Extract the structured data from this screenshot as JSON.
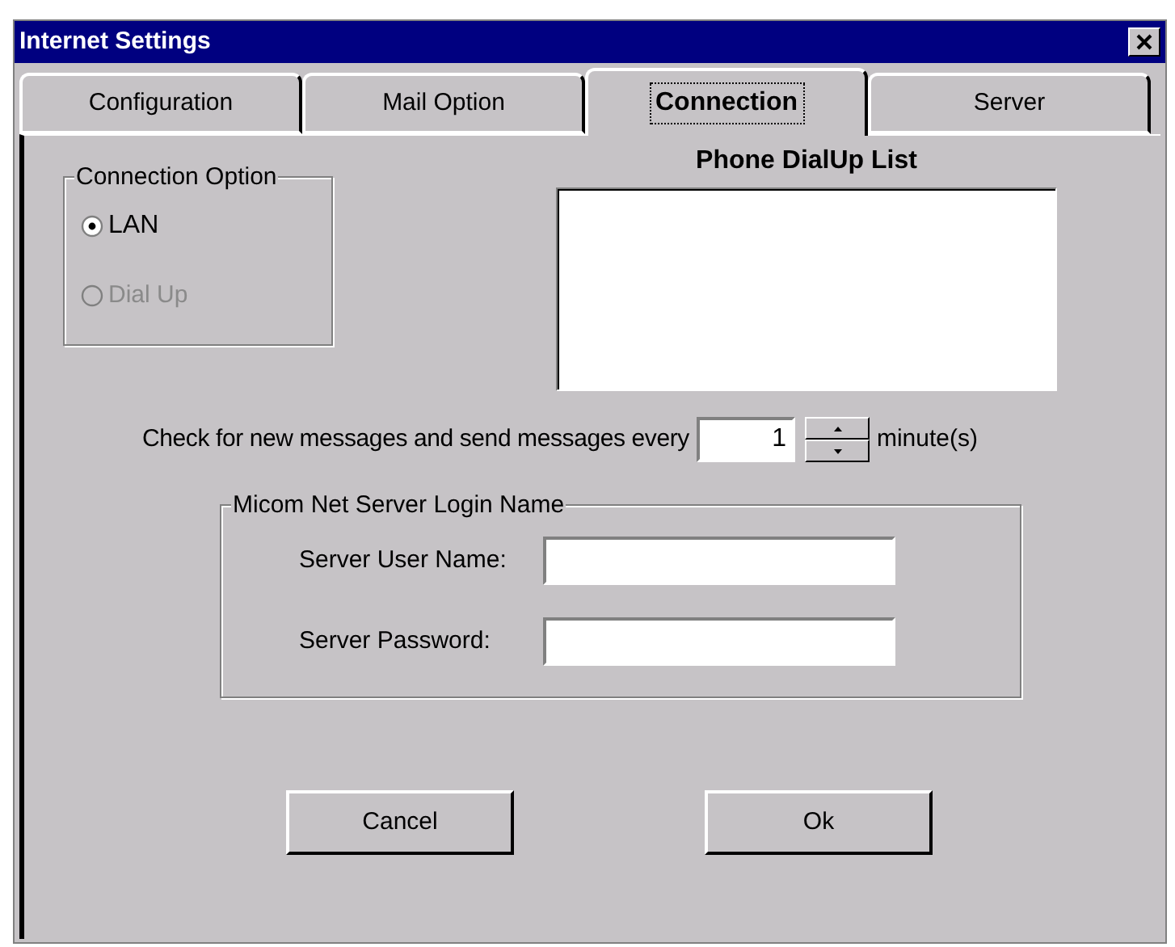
{
  "window": {
    "title": "Internet Settings"
  },
  "tabs": [
    {
      "label": "Configuration",
      "selected": false
    },
    {
      "label": "Mail Option",
      "selected": false
    },
    {
      "label": "Connection",
      "selected": true
    },
    {
      "label": "Server",
      "selected": false
    }
  ],
  "connection_option": {
    "title": "Connection Option",
    "options": [
      {
        "label": "LAN",
        "selected": true,
        "disabled": false
      },
      {
        "label": "Dial Up",
        "selected": false,
        "disabled": true
      }
    ]
  },
  "dialup_list": {
    "title": "Phone DialUp List"
  },
  "check_interval": {
    "label": "Check for new messages and send messages every",
    "value": "1",
    "unit": "minute(s)"
  },
  "login_group": {
    "title": "Micom Net Server Login Name",
    "fields": [
      {
        "label": "Server User Name:"
      },
      {
        "label": "Server Password:"
      }
    ]
  },
  "buttons": [
    "Cancel",
    "Ok"
  ]
}
